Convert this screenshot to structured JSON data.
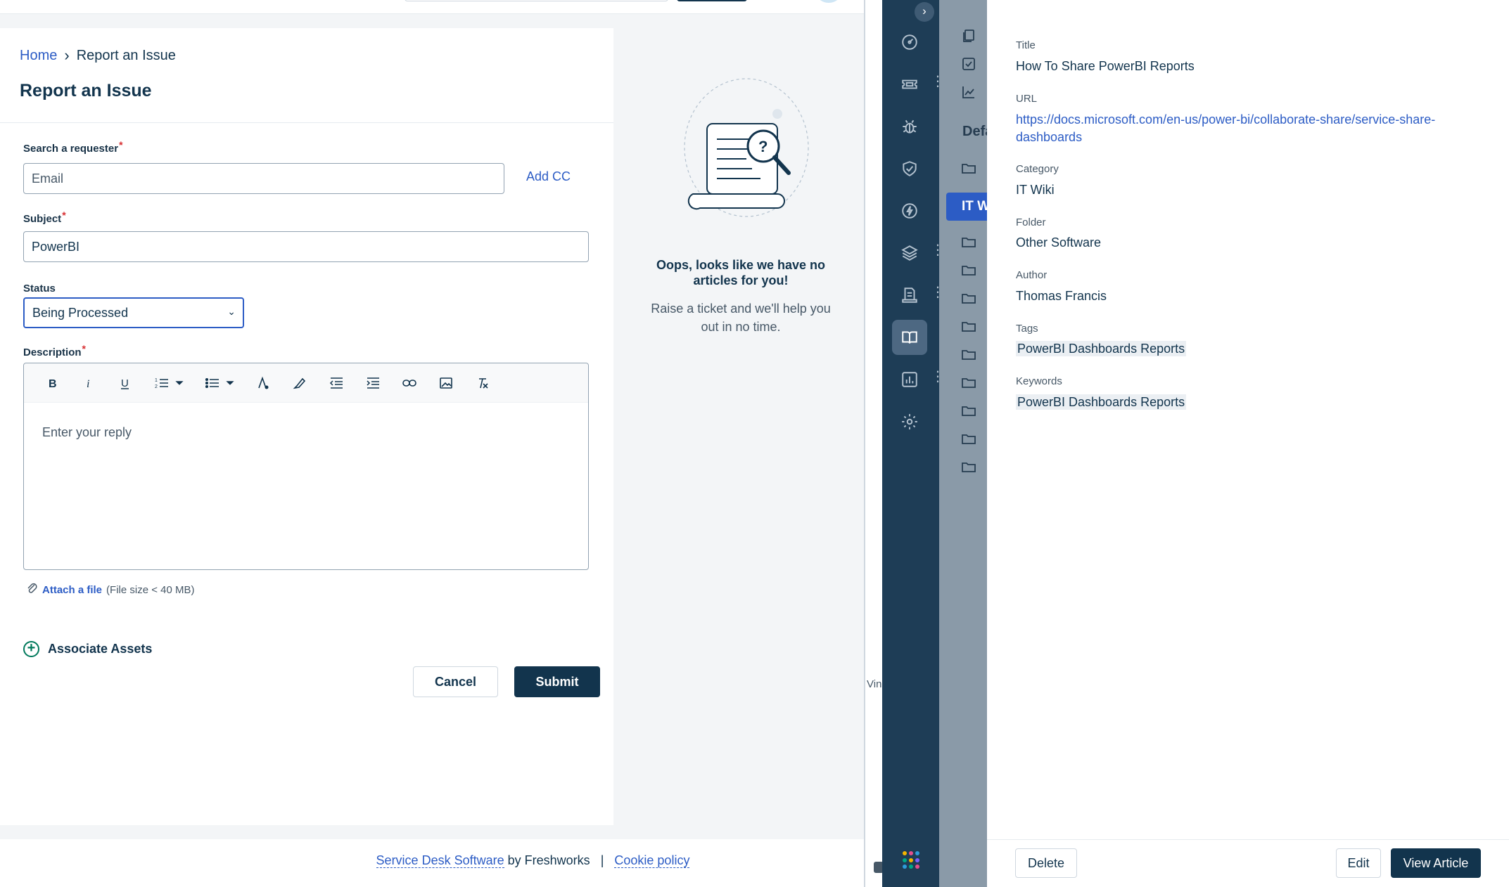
{
  "portal": {
    "breadcrumb": {
      "home": "Home",
      "current": "Report an Issue"
    },
    "page_title": "Report an Issue",
    "form": {
      "requester": {
        "label": "Search a requester",
        "required_mark": "*",
        "placeholder": "Email",
        "add_cc": "Add CC"
      },
      "subject": {
        "label": "Subject",
        "required_mark": "*",
        "value": "PowerBI"
      },
      "status": {
        "label": "Status",
        "value": "Being Processed"
      },
      "description": {
        "label": "Description",
        "required_mark": "*",
        "placeholder": "Enter your reply",
        "toolbar": [
          "bold-icon",
          "italic-icon",
          "underline-icon",
          "ordered-list-icon",
          "unordered-list-icon",
          "text-color-icon",
          "highlight-icon",
          "outdent-icon",
          "indent-icon",
          "link-icon",
          "image-icon",
          "clear-format-icon"
        ]
      },
      "attach": {
        "link": "Attach a file",
        "hint": "(File size < 40 MB)"
      },
      "associate_assets": "Associate Assets",
      "cancel": "Cancel",
      "submit": "Submit"
    },
    "no_articles": {
      "title": "Oops, looks like we have no articles for you!",
      "subtitle": "Raise a ticket and we'll help you out in no time."
    },
    "footer": {
      "link1": "Service Desk Software",
      "by": "by Freshworks",
      "sep": "|",
      "link2": "Cookie policy"
    }
  },
  "app": {
    "gutter_text": "Vind",
    "list_strip": {
      "heading": "Defa",
      "active_item": "IT W"
    },
    "article": {
      "title_label": "Title",
      "title": "How To Share PowerBI Reports",
      "url_label": "URL",
      "url": "https://docs.microsoft.com/en-us/power-bi/collaborate-share/service-share-dashboards",
      "category_label": "Category",
      "category": "IT Wiki",
      "folder_label": "Folder",
      "folder": "Other Software",
      "author_label": "Author",
      "author": "Thomas Francis",
      "tags_label": "Tags",
      "tags": "PowerBI Dashboards Reports",
      "keywords_label": "Keywords",
      "keywords": "PowerBI Dashboards Reports"
    },
    "footer": {
      "delete": "Delete",
      "edit": "Edit",
      "view_article": "View Article"
    },
    "colors": {
      "rail": "#1e3d56",
      "accent": "#2c5cc5",
      "primary_button": "#12344d"
    }
  }
}
